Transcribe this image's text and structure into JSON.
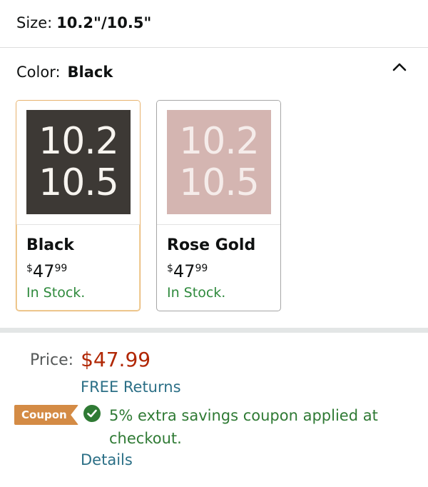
{
  "size": {
    "label": "Size:",
    "value": "10.2\"/10.5\""
  },
  "color": {
    "label": "Color:",
    "value": "Black",
    "collapse_icon": "chevron-up-icon"
  },
  "swatches": [
    {
      "name": "Black",
      "tile_line1": "10.2",
      "tile_line2": "10.5",
      "price_symbol": "$",
      "price_whole": "47",
      "price_fraction": "99",
      "stock": "In Stock.",
      "tile_color": "#3d3935",
      "selected": true
    },
    {
      "name": "Rose Gold",
      "tile_line1": "10.2",
      "tile_line2": "10.5",
      "price_symbol": "$",
      "price_whole": "47",
      "price_fraction": "99",
      "stock": "In Stock.",
      "tile_color": "#d4b5b1",
      "selected": false
    }
  ],
  "price": {
    "label": "Price:",
    "amount": "$47.99",
    "color": "#b12704"
  },
  "returns": "FREE Returns",
  "coupon": {
    "badge": "Coupon",
    "text": "5% extra savings coupon applied at checkout.",
    "icon": "check-circle-icon",
    "badge_color": "#d48b45"
  },
  "details": "Details"
}
